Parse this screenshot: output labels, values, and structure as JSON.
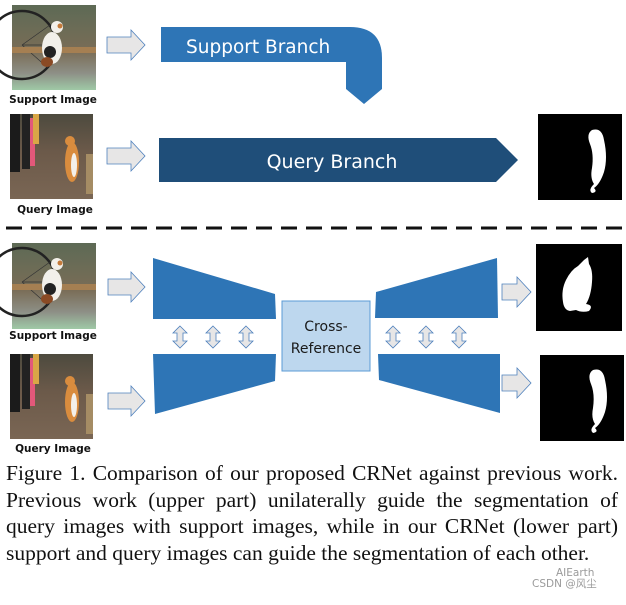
{
  "figure": {
    "upper": {
      "support_image_label": "Support Image",
      "query_image_label": "Query Image",
      "support_branch_label": "Support Branch",
      "query_branch_label": "Query Branch"
    },
    "lower": {
      "support_image_label": "Support Image",
      "query_image_label": "Query Image",
      "cross_reference_label_line1": "Cross-",
      "cross_reference_label_line2": "Reference"
    },
    "colors": {
      "branch_blue": "#2e75b6",
      "query_branch_dark": "#1f4e79",
      "cross_ref_fill": "#bdd7ee",
      "cross_ref_border": "#5b9bd5",
      "arrow_fill": "#e7e6e6",
      "arrow_stroke": "#4f81bd",
      "mask_bg": "#000000",
      "mask_fg": "#ffffff"
    }
  },
  "caption": "Figure 1. Comparison of our proposed CRNet against previous work. Previous work (upper part) unilaterally guide the segmentation of query images with support images, while in our CRNet (lower part) support and query images can guide the segmentation of each other.",
  "watermark": {
    "line1": "AIEarth",
    "line2": "CSDN @风尘"
  }
}
